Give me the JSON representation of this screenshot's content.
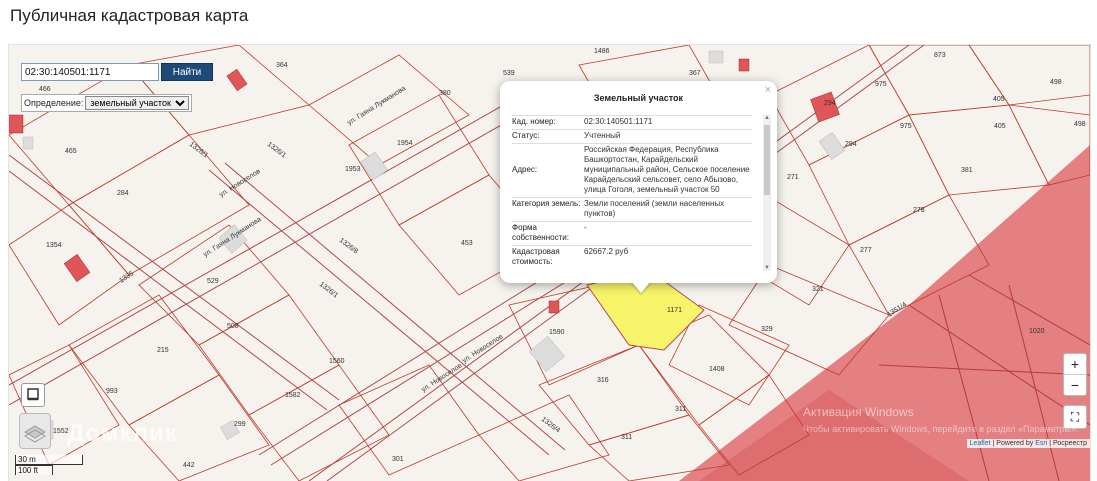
{
  "page": {
    "title": "Публичная кадастровая карта"
  },
  "search": {
    "value": "02:30:140501:1171",
    "button": "Найти"
  },
  "definition": {
    "label": "Определение:",
    "selected": "земельный участок"
  },
  "popup": {
    "title": "Земельный участок",
    "close": "×",
    "rows": [
      {
        "label": "Кад. номер:",
        "value": "02:30:140501:1171"
      },
      {
        "label": "Статус:",
        "value": "Учтенный"
      },
      {
        "label": "Адрес:",
        "value": "Российская Федерация, Республика Башкортостан, Карайдельский муниципальный район, Сельское поселение Карайдельский сельсовет, село Абызово, улица Гоголя, земельный участок 50"
      },
      {
        "label": "Категория земель:",
        "value": "Земли поселений (земли населенных пунктов)"
      },
      {
        "label": "Форма собственности:",
        "value": "-"
      },
      {
        "label": "Кадастровая стоимость:",
        "value": "62667.2 руб"
      }
    ]
  },
  "map": {
    "parcel_labels": [
      "364",
      "1486",
      "539",
      "367",
      "873",
      "975",
      "498",
      "405",
      "466",
      "465",
      "284",
      "1954",
      "1953",
      "380",
      "294",
      "975",
      "405",
      "498",
      "294",
      "271",
      "381",
      "278",
      "1354",
      "529",
      "453",
      "277",
      "321",
      "508",
      "1590",
      "1171",
      "329",
      "1020",
      "215",
      "1560",
      "993",
      "316",
      "1408",
      "1582",
      "311",
      "299",
      "311",
      "1552",
      "442",
      "301"
    ],
    "street_labels": [
      "ул. Гаяна Лукманова",
      "ул. Новоселов",
      "ул. Гаяна Лукманова",
      "ул. Новоселов",
      "ул. Новоселов",
      "1326/1",
      "1326/8",
      "1326/1",
      "1326/1",
      "1326/4",
      "1335",
      "1351/4",
      "1326/1"
    ],
    "colors": {
      "parcel_line": "#c0392b",
      "zone_fill": "#e06b6e",
      "selected_fill": "#f7f46a",
      "background": "#f6f3ee"
    }
  },
  "controls": {
    "zoom_in": "+",
    "zoom_out": "−",
    "fullscreen": "⛶"
  },
  "attribution": {
    "leaflet": "Leaflet",
    "sep1": " | Powered by ",
    "esri": "Esri",
    "sep2": " | Росреестр"
  },
  "watermark": "Домклик",
  "activate": {
    "line1": "Активация Windows",
    "line2": "Чтобы активировать Windows, перейдите в раздел «Параметры»."
  },
  "scale": {
    "metric": "30 m",
    "imperial": "100 ft"
  }
}
